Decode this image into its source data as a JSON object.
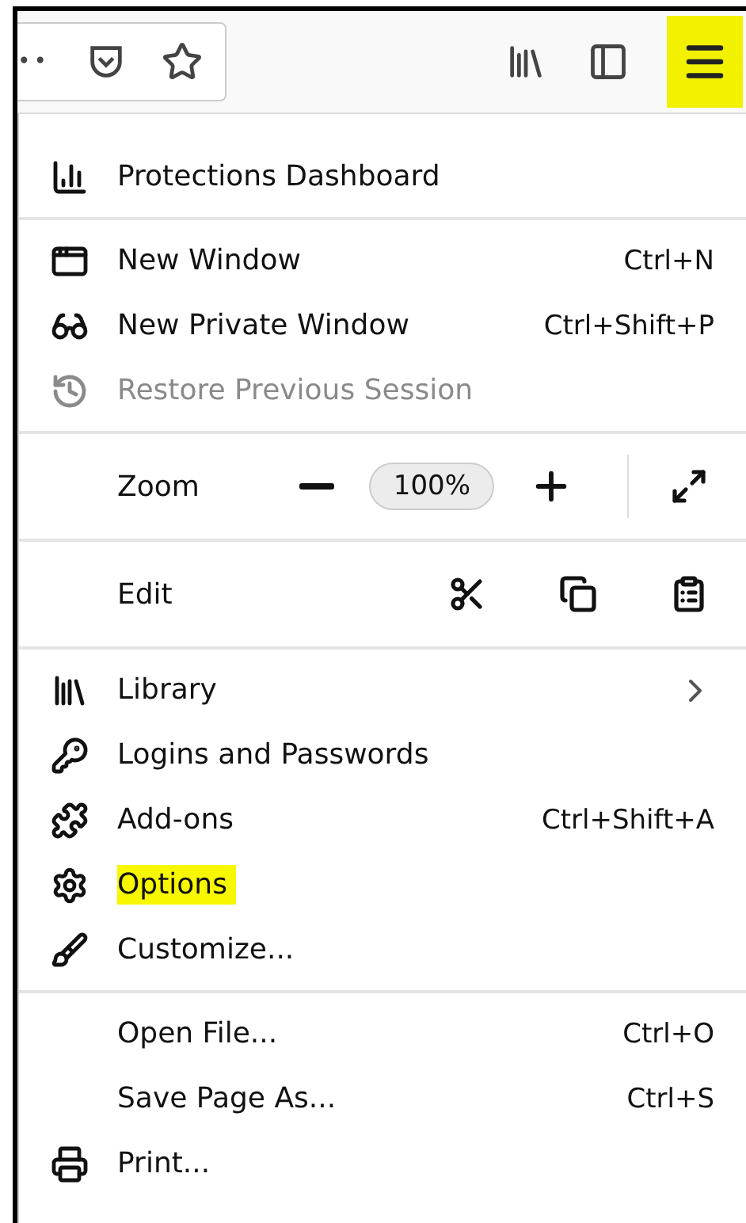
{
  "toolbar": {
    "overflow": "••",
    "menu_button": {
      "highlighted": true
    }
  },
  "menu": {
    "sections": [
      {
        "items": [
          {
            "kind": "item",
            "label": "Protections Dashboard",
            "disabled": false,
            "highlighted": false
          }
        ]
      },
      {
        "items": [
          {
            "kind": "item",
            "label": "New Window",
            "shortcut": "Ctrl+N",
            "disabled": false,
            "highlighted": false
          },
          {
            "kind": "item",
            "label": "New Private Window",
            "shortcut": "Ctrl+Shift+P",
            "disabled": false,
            "highlighted": false
          },
          {
            "kind": "item",
            "label": "Restore Previous Session",
            "disabled": true,
            "highlighted": false
          }
        ]
      },
      {
        "items": [
          {
            "kind": "zoom",
            "label": "Zoom",
            "value": "100%"
          }
        ]
      },
      {
        "items": [
          {
            "kind": "edit",
            "label": "Edit"
          }
        ]
      },
      {
        "items": [
          {
            "kind": "item",
            "label": "Library",
            "submenu": true,
            "disabled": false,
            "highlighted": false
          },
          {
            "kind": "item",
            "label": "Logins and Passwords",
            "disabled": false,
            "highlighted": false
          },
          {
            "kind": "item",
            "label": "Add-ons",
            "shortcut": "Ctrl+Shift+A",
            "disabled": false,
            "highlighted": false
          },
          {
            "kind": "item",
            "label": "Options",
            "disabled": false,
            "highlighted": true
          },
          {
            "kind": "item",
            "label": "Customize...",
            "disabled": false,
            "highlighted": false
          }
        ]
      },
      {
        "items": [
          {
            "kind": "item",
            "label": "Open File...",
            "shortcut": "Ctrl+O",
            "disabled": false,
            "highlighted": false
          },
          {
            "kind": "item",
            "label": "Save Page As...",
            "shortcut": "Ctrl+S",
            "disabled": false,
            "highlighted": false
          },
          {
            "kind": "item",
            "label": "Print...",
            "disabled": false,
            "highlighted": false
          }
        ]
      }
    ]
  }
}
